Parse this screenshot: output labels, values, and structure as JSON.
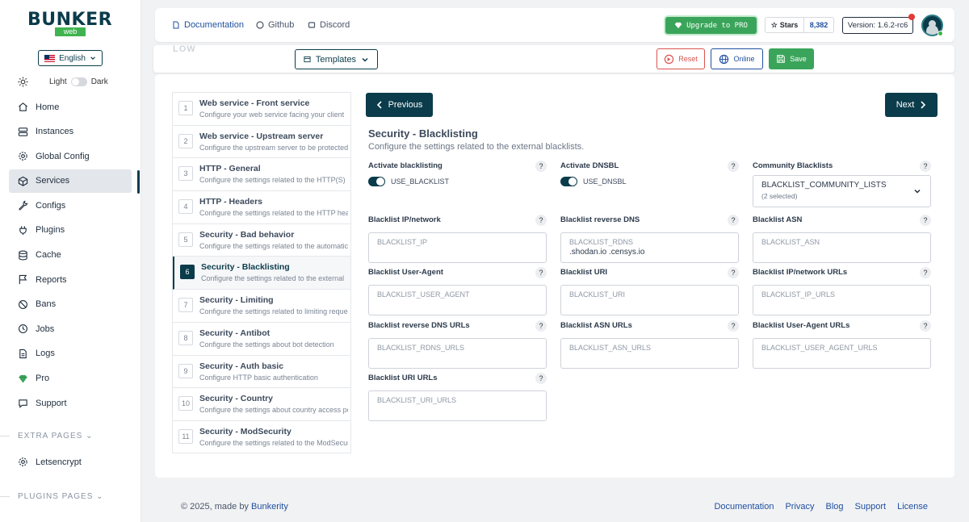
{
  "brand": {
    "name": "BUNKER",
    "sub": "web"
  },
  "language": {
    "label": "English"
  },
  "theme": {
    "light": "Light",
    "dark": "Dark"
  },
  "nav": [
    {
      "label": "Home",
      "icon": "home-icon"
    },
    {
      "label": "Instances",
      "icon": "server-icon"
    },
    {
      "label": "Global Config",
      "icon": "gear-icon"
    },
    {
      "label": "Services",
      "icon": "cube-icon"
    },
    {
      "label": "Configs",
      "icon": "wrench-icon"
    },
    {
      "label": "Plugins",
      "icon": "plug-icon"
    },
    {
      "label": "Cache",
      "icon": "database-icon"
    },
    {
      "label": "Reports",
      "icon": "flag-icon"
    },
    {
      "label": "Bans",
      "icon": "ban-icon"
    },
    {
      "label": "Jobs",
      "icon": "clock-icon"
    },
    {
      "label": "Logs",
      "icon": "file-icon"
    },
    {
      "label": "Pro",
      "icon": "diamond-icon"
    },
    {
      "label": "Support",
      "icon": "chat-icon"
    }
  ],
  "extra_pages": {
    "label": "EXTRA PAGES",
    "items": [
      {
        "label": "Letsencrypt"
      }
    ]
  },
  "plugins_pages": {
    "label": "PLUGINS PAGES"
  },
  "topbar": {
    "documentation": "Documentation",
    "github": "Github",
    "discord": "Discord",
    "upgrade": "Upgrade to PRO",
    "stars_label": "Stars",
    "stars_count": "8,382",
    "version": "Version: 1.6.2-rc6"
  },
  "toolbar": {
    "ghost_title": "LOW",
    "templates": "Templates",
    "reset": "Reset",
    "online": "Online",
    "save": "Save"
  },
  "steps": [
    {
      "num": "1",
      "title": "Web service - Front service",
      "desc": "Configure your web service facing your client"
    },
    {
      "num": "2",
      "title": "Web service - Upstream server",
      "desc": "Configure the upstream server to be protected"
    },
    {
      "num": "3",
      "title": "HTTP - General",
      "desc": "Configure the settings related to the HTTP(S)"
    },
    {
      "num": "4",
      "title": "HTTP - Headers",
      "desc": "Configure the settings related to the HTTP headers"
    },
    {
      "num": "5",
      "title": "Security - Bad behavior",
      "desc": "Configure the settings related to the automatic"
    },
    {
      "num": "6",
      "title": "Security - Blacklisting",
      "desc": "Configure the settings related to the external"
    },
    {
      "num": "7",
      "title": "Security - Limiting",
      "desc": "Configure the settings related to limiting requests"
    },
    {
      "num": "8",
      "title": "Security - Antibot",
      "desc": "Configure the settings about bot detection"
    },
    {
      "num": "9",
      "title": "Security - Auth basic",
      "desc": "Configure HTTP basic authentication"
    },
    {
      "num": "10",
      "title": "Security - Country",
      "desc": "Configure the settings about country access policy"
    },
    {
      "num": "11",
      "title": "Security - ModSecurity",
      "desc": "Configure the settings related to the ModSecurity"
    }
  ],
  "wizard": {
    "previous": "Previous",
    "next": "Next",
    "title": "Security - Blacklisting",
    "description": "Configure the settings related to the external blacklists."
  },
  "fields": {
    "activate_blacklisting": {
      "label": "Activate blacklisting",
      "setting": "USE_BLACKLIST"
    },
    "activate_dnsbl": {
      "label": "Activate DNSBL",
      "setting": "USE_DNSBL"
    },
    "community_blacklists": {
      "label": "Community Blacklists",
      "setting": "BLACKLIST_COMMUNITY_LISTS",
      "selected": "(2 selected)"
    },
    "blacklist_ip": {
      "label": "Blacklist IP/network",
      "placeholder": "BLACKLIST_IP",
      "value": ""
    },
    "blacklist_rdns": {
      "label": "Blacklist reverse DNS",
      "placeholder": "BLACKLIST_RDNS",
      "value": ".shodan.io .censys.io"
    },
    "blacklist_asn": {
      "label": "Blacklist ASN",
      "placeholder": "BLACKLIST_ASN",
      "value": ""
    },
    "blacklist_user_agent": {
      "label": "Blacklist User-Agent",
      "placeholder": "BLACKLIST_USER_AGENT",
      "value": ""
    },
    "blacklist_uri": {
      "label": "Blacklist URI",
      "placeholder": "BLACKLIST_URI",
      "value": ""
    },
    "blacklist_ip_urls": {
      "label": "Blacklist IP/network URLs",
      "placeholder": "BLACKLIST_IP_URLS",
      "value": ""
    },
    "blacklist_rdns_urls": {
      "label": "Blacklist reverse DNS URLs",
      "placeholder": "BLACKLIST_RDNS_URLS",
      "value": ""
    },
    "blacklist_asn_urls": {
      "label": "Blacklist ASN URLs",
      "placeholder": "BLACKLIST_ASN_URLS",
      "value": ""
    },
    "blacklist_user_agent_urls": {
      "label": "Blacklist User-Agent URLs",
      "placeholder": "BLACKLIST_USER_AGENT_URLS",
      "value": ""
    },
    "blacklist_uri_urls": {
      "label": "Blacklist URI URLs",
      "placeholder": "BLACKLIST_URI_URLS",
      "value": ""
    }
  },
  "help_glyph": "?",
  "footer": {
    "copyright": "© 2025, made by ",
    "author": "Bunkerity",
    "links": [
      "Documentation",
      "Privacy",
      "Blog",
      "Support",
      "License"
    ]
  },
  "colors": {
    "primary": "#0b3c4b",
    "success": "#3aa55a",
    "danger": "#d9534f",
    "link": "#1f4f9f"
  }
}
